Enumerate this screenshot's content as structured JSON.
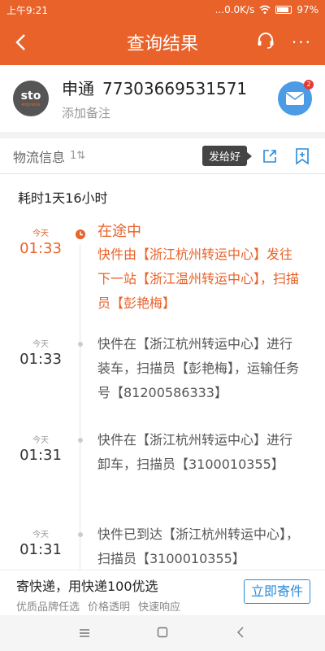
{
  "status_bar": {
    "time": "上午9:21",
    "net": "...0.0K/s",
    "battery": "97%"
  },
  "header": {
    "title": "查询结果",
    "back_icon": "chevron-left-icon",
    "support_icon": "headset-icon",
    "more_label": "···"
  },
  "company": {
    "logo_text": "sto",
    "logo_sub": "express",
    "name": "申通",
    "tracking_number": "77303669531571",
    "note_label": "添加备注",
    "mail_badge": "2"
  },
  "info": {
    "label": "物流信息",
    "sort_label": "1⇅",
    "share_tip": "发给好"
  },
  "elapsed": "耗时1天16小时",
  "events": [
    {
      "day": "今天",
      "time": "01:33",
      "status": "在途中",
      "text": "快件由【浙江杭州转运中心】发往下一站【浙江温州转运中心】，扫描员【彭艳梅】"
    },
    {
      "day": "今天",
      "time": "01:33",
      "status": "",
      "text": "快件在【浙江杭州转运中心】进行装车，扫描员【彭艳梅】，运输任务号【81200586333】"
    },
    {
      "day": "今天",
      "time": "01:31",
      "status": "",
      "text": "快件在【浙江杭州转运中心】进行卸车，扫描员【3100010355】"
    },
    {
      "day": "今天",
      "time": "01:31",
      "status": "",
      "text": "快件已到达【浙江杭州转运中心】，扫描员【3100010355】"
    }
  ],
  "promo": {
    "headline": "寄快递，用快递100优选",
    "features": [
      "优质品牌任选",
      "价格透明",
      "快速响应"
    ],
    "button": "立即寄件"
  },
  "colors": {
    "accent": "#e8622a",
    "link": "#2a8bd8"
  }
}
